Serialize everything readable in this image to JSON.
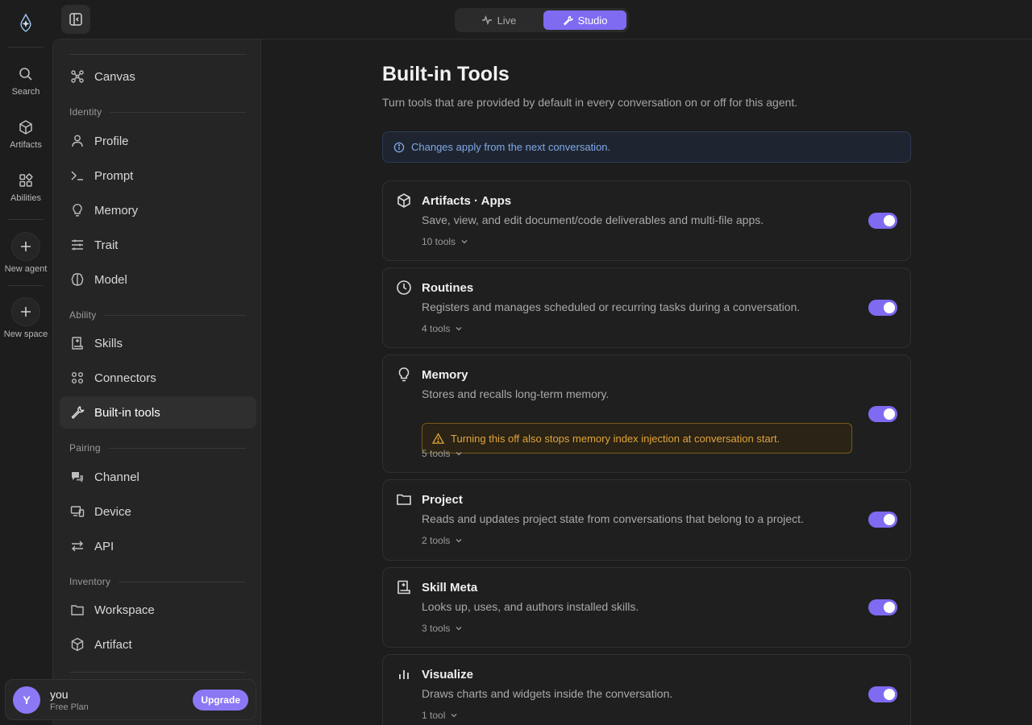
{
  "rail": {
    "items": [
      {
        "label": "Search",
        "icon": "search-icon"
      },
      {
        "label": "Artifacts",
        "icon": "cube-icon"
      },
      {
        "label": "Abilities",
        "icon": "grid-icon"
      },
      {
        "label": "New agent",
        "icon": "plus-icon"
      },
      {
        "label": "New space",
        "icon": "plus-icon"
      }
    ]
  },
  "mode": {
    "live": "Live",
    "studio": "Studio",
    "active": "studio"
  },
  "nav": {
    "canvas": "Canvas",
    "sections": {
      "identity": "Identity",
      "ability": "Ability",
      "pairing": "Pairing",
      "inventory": "Inventory"
    },
    "identity_items": [
      "Profile",
      "Prompt",
      "Memory",
      "Trait",
      "Model"
    ],
    "ability_items": [
      "Skills",
      "Connectors",
      "Built-in tools"
    ],
    "pairing_items": [
      "Channel",
      "Device",
      "API"
    ],
    "inventory_items": [
      "Workspace",
      "Artifact"
    ],
    "active": "Built-in tools"
  },
  "user": {
    "initial": "Y",
    "name": "you",
    "plan": "Free Plan",
    "upgrade": "Upgrade"
  },
  "main": {
    "title": "Built-in Tools",
    "subtitle": "Turn tools that are provided by default in every conversation on or off for this agent.",
    "notice": "Changes apply from the next conversation.",
    "cards": [
      {
        "title": "Artifacts · Apps",
        "desc": "Save, view, and edit document/code deliverables and multi-file apps.",
        "tools": "10 tools",
        "enabled": true,
        "icon": "cube-icon"
      },
      {
        "title": "Routines",
        "desc": "Registers and manages scheduled or recurring tasks during a conversation.",
        "tools": "4 tools",
        "enabled": true,
        "icon": "clock-icon"
      },
      {
        "title": "Memory",
        "desc": "Stores and recalls long-term memory.",
        "warning": "Turning this off also stops memory index injection at conversation start.",
        "tools": "5 tools",
        "enabled": true,
        "icon": "lightbulb-icon"
      },
      {
        "title": "Project",
        "desc": "Reads and updates project state from conversations that belong to a project.",
        "tools": "2 tools",
        "enabled": true,
        "icon": "folder-icon"
      },
      {
        "title": "Skill Meta",
        "desc": "Looks up, uses, and authors installed skills.",
        "tools": "3 tools",
        "enabled": true,
        "icon": "scroll-icon"
      },
      {
        "title": "Visualize",
        "desc": "Draws charts and widgets inside the conversation.",
        "tools": "1 tool",
        "enabled": true,
        "icon": "bar-chart-icon"
      }
    ]
  },
  "colors": {
    "accent": "#7e6bf2",
    "avatar": "#8b78f5",
    "info": "#7fa8e6",
    "warning": "#e2a43a"
  }
}
